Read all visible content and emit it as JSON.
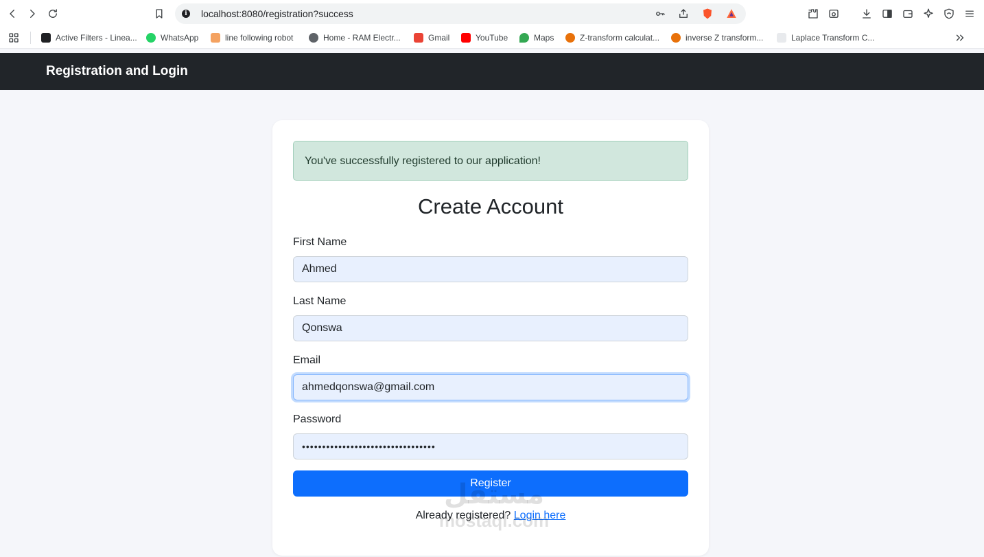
{
  "browser": {
    "url": "localhost:8080/registration?success",
    "bookmarks": [
      {
        "label": "Active Filters - Linea...",
        "icon": "doc-icon",
        "color": "#202124"
      },
      {
        "label": "WhatsApp",
        "icon": "whatsapp-icon",
        "color": "#25d366"
      },
      {
        "label": "line following robot",
        "icon": "robot-icon",
        "color": "#f4a261"
      },
      {
        "label": "Home - RAM Electr...",
        "icon": "globe-icon",
        "color": "#5f6368"
      },
      {
        "label": "Gmail",
        "icon": "gmail-icon",
        "color": "#ea4335"
      },
      {
        "label": "YouTube",
        "icon": "youtube-icon",
        "color": "#ff0000"
      },
      {
        "label": "Maps",
        "icon": "maps-icon",
        "color": "#34a853"
      },
      {
        "label": "Z-transform calculat...",
        "icon": "gear-icon",
        "color": "#e8710a"
      },
      {
        "label": "inverse Z transform...",
        "icon": "gear-icon",
        "color": "#e8710a"
      },
      {
        "label": "Laplace Transform C...",
        "icon": "zm-icon",
        "color": "#5f6368"
      }
    ]
  },
  "navbar": {
    "brand": "Registration and Login"
  },
  "alert": {
    "message": "You've successfully registered to our application!",
    "color": "#d1e7dd"
  },
  "form": {
    "title": "Create Account",
    "first_name_label": "First Name",
    "first_name_value": "Ahmed",
    "last_name_label": "Last Name",
    "last_name_value": "Qonswa",
    "email_label": "Email",
    "email_value": "ahmedqonswa@gmail.com",
    "password_label": "Password",
    "password_value": "•••••••••••••••••••••••••••••••••",
    "submit_label": "Register",
    "footer_text": "Already registered?",
    "login_link": "Login here"
  },
  "watermark": {
    "arabic": "مستقل",
    "latin": "mostaql.com"
  },
  "colors": {
    "primary": "#0d6efd",
    "navbar": "#212529",
    "page_bg": "#f5f6fa"
  }
}
